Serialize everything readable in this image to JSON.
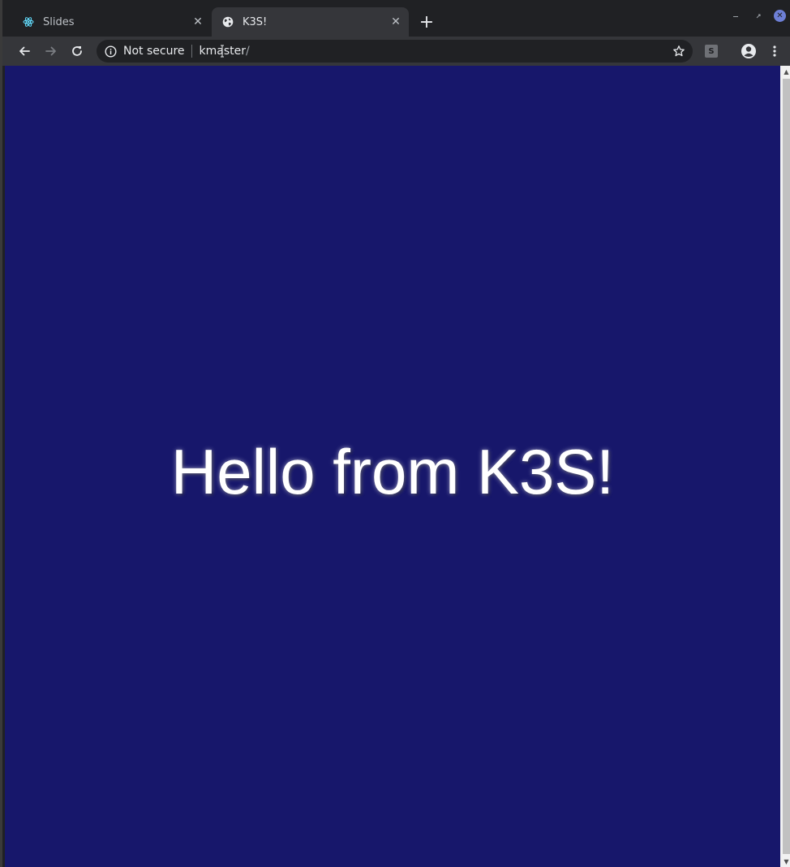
{
  "tabs": [
    {
      "label": "Slides",
      "favicon": "react-atom-icon",
      "active": false
    },
    {
      "label": "K3S!",
      "favicon": "globe-icon",
      "active": true
    }
  ],
  "toolbar": {
    "security_label": "Not secure",
    "url_host": "kmaster",
    "url_path": "/"
  },
  "extension_label": "S",
  "page": {
    "heading": "Hello from K3S!",
    "background_color": "#17176b",
    "text_color": "#ffffff"
  }
}
